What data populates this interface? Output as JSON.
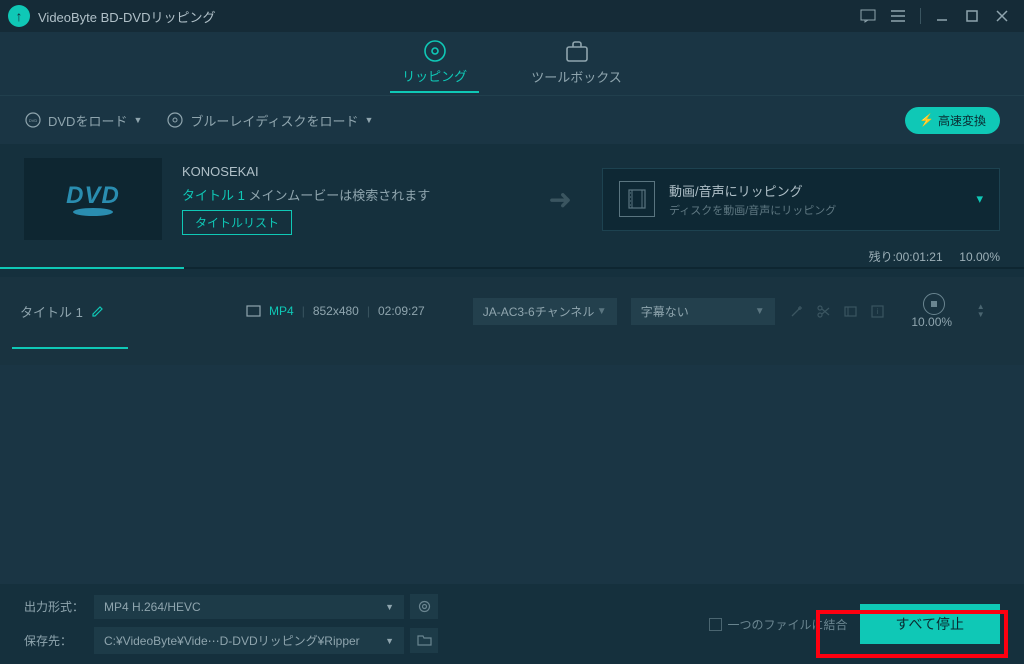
{
  "app": {
    "title": "VideoByte BD-DVDリッピング"
  },
  "tabs": {
    "ripping": "リッピング",
    "toolbox": "ツールボックス"
  },
  "loadbar": {
    "load_dvd": "DVDをロード",
    "load_bluray": "ブルーレイディスクをロード",
    "speed_badge": "高速変換"
  },
  "disc": {
    "name": "KONOSEKAI",
    "title_label": "タイトル 1",
    "main_movie_text": "メインムービーは検索されます",
    "title_list_btn": "タイトルリスト",
    "rip_target_title": "動画/音声にリッピング",
    "rip_target_sub": "ディスクを動画/音声にリッピング",
    "remaining_label": "残り:",
    "remaining_time": "00:01:21",
    "progress_percent": "10.00%"
  },
  "title_row": {
    "name": "タイトル 1",
    "format": "MP4",
    "resolution": "852x480",
    "duration": "02:09:27",
    "audio_track": "JA-AC3-6チャンネル",
    "subtitle": "字幕ない",
    "percent": "10.00%"
  },
  "bottom": {
    "output_format_label": "出力形式：",
    "output_format_value": "MP4 H.264/HEVC",
    "save_to_label": "保存先：",
    "save_to_value": "C:¥VideoByte¥Vide⋯D-DVDリッピング¥Ripper",
    "merge_label": "一つのファイルに結合",
    "stop_all": "すべて停止"
  }
}
